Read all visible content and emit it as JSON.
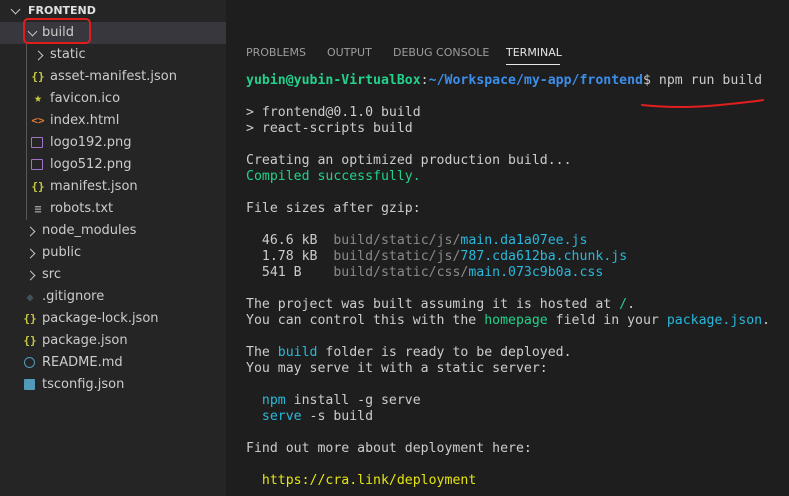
{
  "explorer": {
    "root": "FRONTEND",
    "items": [
      {
        "label": "build",
        "kind": "folder-open",
        "depth": 1
      },
      {
        "label": "static",
        "kind": "folder",
        "depth": 2
      },
      {
        "label": "asset-manifest.json",
        "kind": "json",
        "depth": 2
      },
      {
        "label": "favicon.ico",
        "kind": "favicon",
        "depth": 2
      },
      {
        "label": "index.html",
        "kind": "html",
        "depth": 2
      },
      {
        "label": "logo192.png",
        "kind": "image",
        "depth": 2
      },
      {
        "label": "logo512.png",
        "kind": "image",
        "depth": 2
      },
      {
        "label": "manifest.json",
        "kind": "json",
        "depth": 2
      },
      {
        "label": "robots.txt",
        "kind": "text",
        "depth": 2
      },
      {
        "label": "node_modules",
        "kind": "folder",
        "depth": 1
      },
      {
        "label": "public",
        "kind": "folder",
        "depth": 1
      },
      {
        "label": "src",
        "kind": "folder",
        "depth": 1
      },
      {
        "label": ".gitignore",
        "kind": "git",
        "depth": 1
      },
      {
        "label": "package-lock.json",
        "kind": "json",
        "depth": 1
      },
      {
        "label": "package.json",
        "kind": "json",
        "depth": 1
      },
      {
        "label": "README.md",
        "kind": "info",
        "depth": 1
      },
      {
        "label": "tsconfig.json",
        "kind": "ts",
        "depth": 1
      }
    ]
  },
  "panel_tabs": [
    "PROBLEMS",
    "OUTPUT",
    "DEBUG CONSOLE",
    "TERMINAL"
  ],
  "active_tab": "TERMINAL",
  "terminal": {
    "prompt_user": "yubin@yubin-VirtualBox",
    "prompt_colon": ":",
    "prompt_path": "~/Workspace/my-app/frontend",
    "prompt_cmd": "$ npm run build",
    "line_script1": "> frontend@0.1.0 build",
    "line_script2": "> react-scripts build",
    "line_creating": "Creating an optimized production build...",
    "line_compiled": "Compiled successfully.",
    "line_sizes_header": "File sizes after gzip:",
    "files": [
      {
        "size": "46.6 kB",
        "dir": "build/static/js/",
        "name": "main.da1a07ee.js"
      },
      {
        "size": "1.78 kB",
        "dir": "build/static/js/",
        "name": "787.cda612ba.chunk.js"
      },
      {
        "size": "541 B  ",
        "dir": "build/static/css/",
        "name": "main.073c9b0a.css"
      }
    ],
    "hosted_pre": "The project was built assuming it is hosted at ",
    "hosted_path": "/",
    "hosted_post": ".",
    "control_pre": "You can control this with the ",
    "control_field": "homepage",
    "control_mid": " field in your ",
    "control_file": "package.json",
    "control_post": ".",
    "ready_pre": "The ",
    "ready_folder": "build",
    "ready_post": " folder is ready to be deployed.",
    "serve_line": "You may serve it with a static server:",
    "cmd1_a": "npm",
    "cmd1_b": " install -g serve",
    "cmd2_a": "serve",
    "cmd2_b": " -s build",
    "findout": "Find out more about deployment here:",
    "link": "https://cra.link/deployment"
  }
}
